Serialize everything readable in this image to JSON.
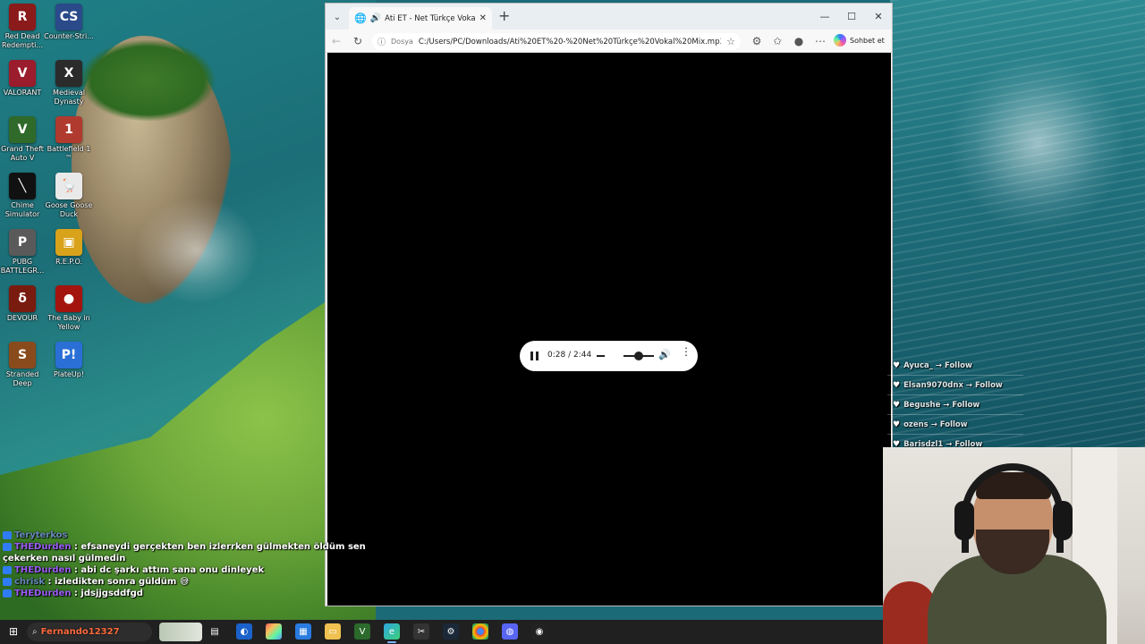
{
  "desktop": {
    "icons": [
      {
        "label": "Red Dead Redempti...",
        "name": "red-dead-icon",
        "color": "#8b1a1a",
        "glyph": "R"
      },
      {
        "label": "Counter-Stri...",
        "name": "counter-strike-icon",
        "color": "#2a4a8a",
        "glyph": "CS"
      },
      {
        "label": "VALORANT",
        "name": "valorant-icon",
        "color": "#9b1c2c",
        "glyph": "V"
      },
      {
        "label": "Medieval Dynasty",
        "name": "medieval-dynasty-icon",
        "color": "#2b2b2b",
        "glyph": "X"
      },
      {
        "label": "Grand Theft Auto V",
        "name": "gta-v-icon",
        "color": "#2f6a2a",
        "glyph": "V"
      },
      {
        "label": "Battlefield 1 ™",
        "name": "battlefield-icon",
        "color": "#b03a2e",
        "glyph": "1"
      },
      {
        "label": "Chime Simulator",
        "name": "chime-simulator-icon",
        "color": "#111111",
        "glyph": "╲"
      },
      {
        "label": "Goose Goose Duck",
        "name": "goose-goose-duck-icon",
        "color": "#e9e9e9",
        "glyph": "🪿"
      },
      {
        "label": "PUBG BATTLEGR...",
        "name": "pubg-icon",
        "color": "#5a5a5a",
        "glyph": "P"
      },
      {
        "label": "R.E.P.O.",
        "name": "repo-icon",
        "color": "#d8a21a",
        "glyph": "▣"
      },
      {
        "label": "DEVOUR",
        "name": "devour-icon",
        "color": "#7a1b0f",
        "glyph": "δ"
      },
      {
        "label": "The Baby in Yellow",
        "name": "baby-in-yellow-icon",
        "color": "#a3140f",
        "glyph": "●"
      },
      {
        "label": "Stranded Deep",
        "name": "stranded-deep-icon",
        "color": "#8a4b1c",
        "glyph": "S"
      },
      {
        "label": "PlateUp!",
        "name": "plateup-icon",
        "color": "#2a6fd6",
        "glyph": "P!"
      }
    ]
  },
  "browser": {
    "tab_title": "Ati ET - Net Türkçe Vokal Mix",
    "address_scheme": "Dosya",
    "address_url": "C:/Users/PC/Downloads/Ati%20ET%20-%20Net%20Türkçe%20Vokal%20Mix.mp3",
    "copilot_label": "Sohbet et"
  },
  "media": {
    "time": "0:28 / 2:44",
    "volume_fraction": 0.5,
    "state": "playing"
  },
  "chat": [
    {
      "user": "Teryterkos",
      "text": "",
      "faint": true
    },
    {
      "user": "THEDurden",
      "text": "efsaneydi gerçekten ben izlerrken gülmekten öldüm sen çekerken nasıl gülmedin"
    },
    {
      "user": "THEDurden",
      "text": "abi dc şarkı attım sana onu dinleyek"
    },
    {
      "user": "chrisk",
      "text": "izledikten sonra güldüm 😅",
      "faint": true
    },
    {
      "user": "THEDurden",
      "text": "jdsjjgsddfgd"
    }
  ],
  "follows": [
    {
      "text": "Ayuca_ → Follow"
    },
    {
      "text": "Elsan9070dnx → Follow"
    },
    {
      "text": "Begushe → Follow"
    },
    {
      "text": "ozens → Follow"
    },
    {
      "text": "Barisdzl1 → Follow"
    }
  ],
  "taskbar": {
    "search_user": "Fernando12327",
    "active_app": "edge"
  }
}
